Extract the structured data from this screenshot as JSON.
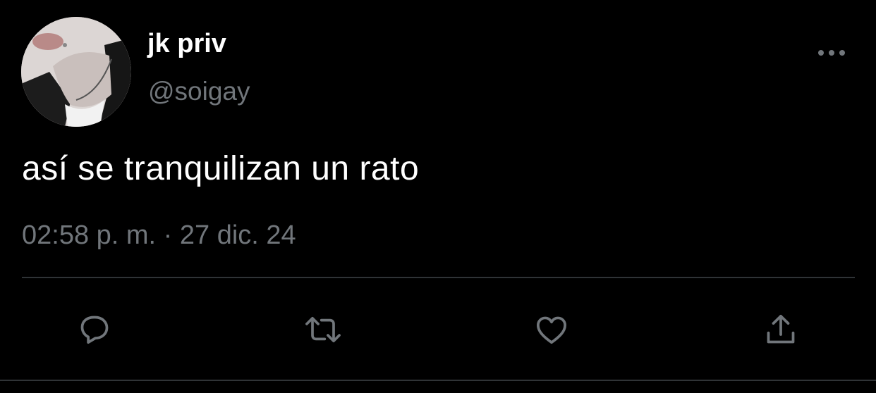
{
  "user": {
    "display_name": "jk priv",
    "handle": "@soigay",
    "avatar_alt": "profile photo"
  },
  "tweet": {
    "text": "así se tranquilizan un rato",
    "timestamp": "02:58 p. m. · 27 dic. 24"
  },
  "actions": {
    "reply_icon": "speech-bubble-icon",
    "retweet_icon": "retweet-arrows-icon",
    "like_icon": "heart-icon",
    "share_icon": "upload-arrow-icon",
    "more_icon": "ellipsis-icon"
  },
  "colors": {
    "background": "#000000",
    "primary_text": "#ffffff",
    "secondary_text": "#71767b",
    "divider": "#2f3336",
    "icon": "#71767b"
  }
}
